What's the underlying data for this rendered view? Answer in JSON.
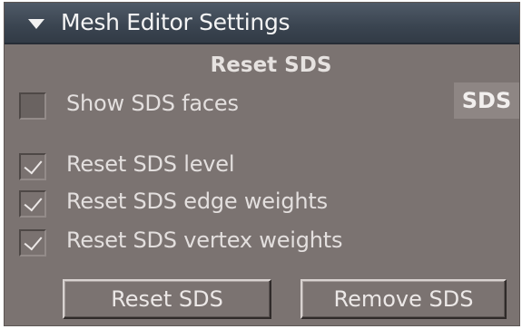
{
  "header": {
    "title": "Mesh Editor Settings",
    "collapse_icon": "triangle-down-icon"
  },
  "section": {
    "title": "Reset SDS",
    "tag": "SDS"
  },
  "options": [
    {
      "label": "Show SDS faces",
      "checked": false
    },
    {
      "label": "Reset SDS level",
      "checked": true
    },
    {
      "label": "Reset SDS edge weights",
      "checked": true
    },
    {
      "label": "Reset SDS vertex weights",
      "checked": true
    }
  ],
  "buttons": {
    "reset_label": "Reset SDS",
    "remove_label": "Remove SDS"
  }
}
